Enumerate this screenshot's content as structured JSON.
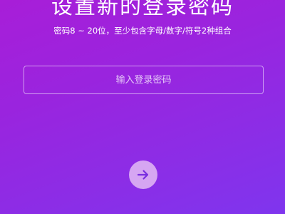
{
  "header": {
    "title": "设置新的登录密码",
    "subtitle": "密码8 ~ 20位，至少包含字母/数字/符号2种组合"
  },
  "password": {
    "placeholder": "输入登录密码",
    "value": ""
  },
  "next_button": {
    "icon": "arrow-right-icon",
    "icon_color": "#7a2fe0",
    "background": "#d6a6f2"
  },
  "colors": {
    "background_start": "#a81ed8",
    "background_end": "#7f35ee",
    "text": "#ffffff"
  }
}
